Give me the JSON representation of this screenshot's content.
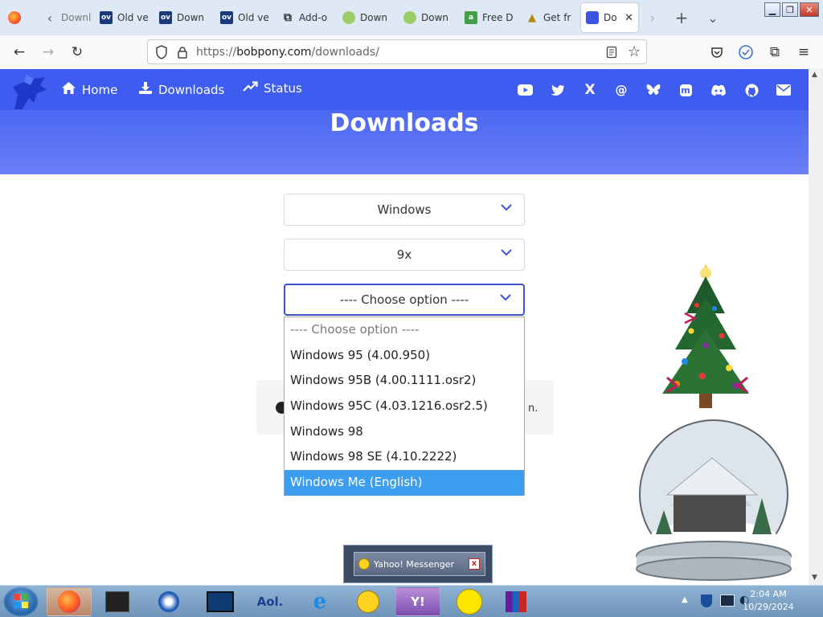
{
  "browser": {
    "tabs": [
      {
        "label": "Downl",
        "favicon": "firefox-tab-icon"
      },
      {
        "label": "Old ve",
        "favicon": "oldversion-icon"
      },
      {
        "label": "Down",
        "favicon": "oldversion-icon"
      },
      {
        "label": "Old ve",
        "favicon": "oldversion-icon"
      },
      {
        "label": "Add-o",
        "favicon": "puzzle-icon"
      },
      {
        "label": "Down",
        "favicon": "frog-icon"
      },
      {
        "label": "Down",
        "favicon": "frog-icon"
      },
      {
        "label": "Free D",
        "favicon": "amazon-icon"
      },
      {
        "label": "Get fr",
        "favicon": "poo-icon"
      },
      {
        "label": "Do",
        "favicon": "bobpony-icon"
      }
    ],
    "ov_letters": "ov",
    "amazon_letter": "a",
    "tab_close_glyph": "✕",
    "new_tab_glyph": "+",
    "tab_list_glyph": "⌄",
    "url_prefix": "https://",
    "url_host": "bobpony.com",
    "url_path": "/downloads/"
  },
  "site": {
    "nav": {
      "home": "Home",
      "downloads": "Downloads",
      "status": "Status"
    },
    "social_icons": [
      "youtube-icon",
      "twitter-icon",
      "x-icon",
      "threads-icon",
      "bluesky-icon",
      "mastodon-icon",
      "discord-icon",
      "github-icon",
      "mail-icon"
    ],
    "social_glyphs": {
      "x": "X",
      "threads": "@",
      "mastodon": "m"
    },
    "page_title": "Downloads",
    "os_select_value": "Windows",
    "family_select_value": "9x",
    "version_select_value": "---- Choose option ----",
    "dropdown_options": [
      "---- Choose option ----",
      "Windows 95 (4.00.950)",
      "Windows 95B (4.00.1111.osr2)",
      "Windows 95C (4.03.1216.osr2.5)",
      "Windows 98",
      "Windows 98 SE (4.10.2222)",
      "Windows Me (English)"
    ],
    "highlighted_option": "Windows Me (English)",
    "info_tail": "n."
  },
  "colors": {
    "header_blue": "#3f5cf0",
    "accent": "#3b52d4",
    "highlight": "#3d9df0"
  },
  "yahoo_popup": {
    "label": "Yahoo! Messenger",
    "close_glyph": "x"
  },
  "taskbar": {
    "items": [
      "firefox",
      "dark-app",
      "media-player",
      "monitor",
      "aol",
      "internet-explorer",
      "yahoo-smiley",
      "yahoo-messenger",
      "smiley",
      "winrar"
    ],
    "aol_label": "Aol.",
    "yahoo_label": "Y!",
    "clock_time": "2:04 AM",
    "clock_date": "10/29/2024"
  }
}
